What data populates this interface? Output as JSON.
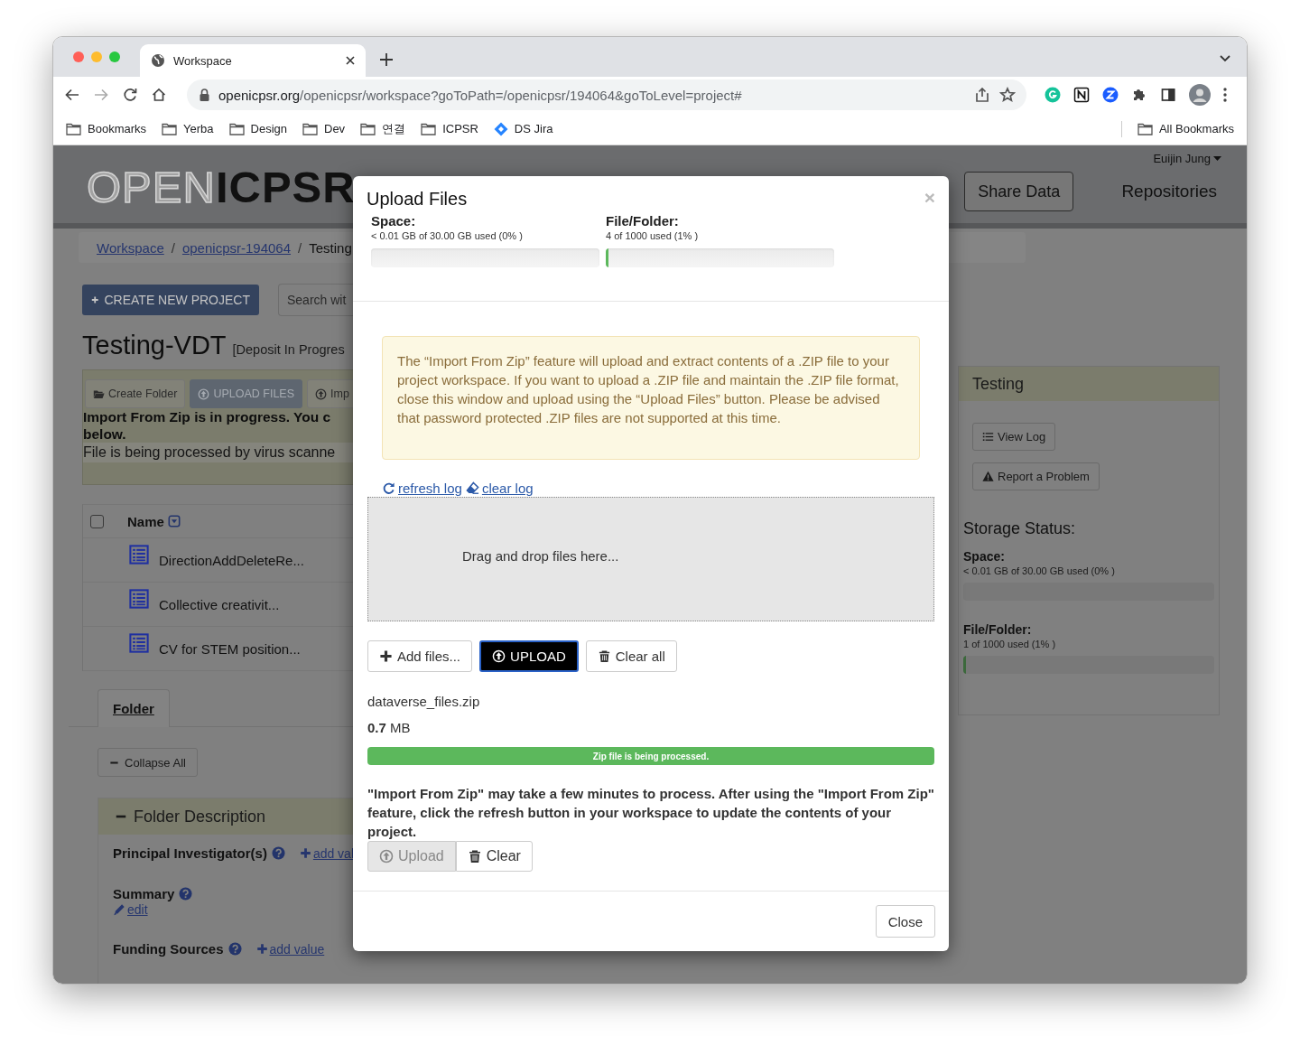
{
  "browser": {
    "tab": {
      "title": "Workspace",
      "selected": true
    },
    "url": {
      "host": "openicpsr.org",
      "path": "/openicpsr/workspace?goToPath=/openicpsr/194064&goToLevel=project#"
    },
    "bookmarks": [
      {
        "label": "Bookmarks",
        "kind": "folder"
      },
      {
        "label": "Yerba",
        "kind": "folder"
      },
      {
        "label": "Design",
        "kind": "folder"
      },
      {
        "label": "Dev",
        "kind": "folder"
      },
      {
        "label": "연결",
        "kind": "folder"
      },
      {
        "label": "ICPSR",
        "kind": "folder"
      },
      {
        "label": "DS Jira",
        "kind": "jira"
      }
    ],
    "all_bookmarks": "All Bookmarks"
  },
  "header": {
    "logo": {
      "light": "OPEN",
      "bold": "ICPSR"
    },
    "user": "Euijin Jung",
    "share_button": "Share Data",
    "nav_link": "Repositories"
  },
  "breadcrumb": [
    {
      "label": "Workspace",
      "kind": "link"
    },
    {
      "label": "/",
      "kind": "separator"
    },
    {
      "label": "openicpsr-194064",
      "kind": "link"
    },
    {
      "label": "/",
      "kind": "separator"
    },
    {
      "label": "Testing",
      "kind": "current"
    }
  ],
  "create_button": "CREATE NEW PROJECT",
  "search": {
    "placeholder": "Search wit"
  },
  "project": {
    "title": "Testing-VDT",
    "status": "[Deposit In Progres"
  },
  "toolbar": [
    {
      "label": "Create Folder",
      "kind": "default"
    },
    {
      "label": "UPLOAD FILES",
      "kind": "primary"
    },
    {
      "label": "Imp",
      "kind": "default"
    }
  ],
  "notice": {
    "lines": [
      "Import From Zip is in progress. You c",
      "below."
    ],
    "status": "File is being processed by virus scanne"
  },
  "table": {
    "select_all": {
      "checked": false
    },
    "columns": [
      "Name"
    ],
    "rows": [
      {
        "name": "DirectionAddDeleteRe..."
      },
      {
        "name": "Collective creativit..."
      },
      {
        "name": "CV for STEM position..."
      }
    ]
  },
  "folder_tabs": [
    {
      "label": "Folder",
      "selected": true
    }
  ],
  "collapse_button": "Collapse All",
  "folder_description": {
    "title": "Folder Description",
    "fields": [
      {
        "label": "Principal Investigator(s)",
        "action": "add val",
        "kind": "add"
      },
      {
        "label": "Summary",
        "action": "edit",
        "kind": "edit"
      },
      {
        "label": "Funding Sources",
        "action": "add value",
        "kind": "add"
      }
    ]
  },
  "side_panel": {
    "title": "Testing",
    "buttons": [
      {
        "label": "View Log",
        "kind": "log"
      },
      {
        "label": "Report a Problem",
        "kind": "report"
      }
    ],
    "storage_title": "Storage Status:",
    "stats": [
      {
        "label": "Space:",
        "usage": "< 0.01 GB of 30.00 GB used (0% )",
        "level": 0
      },
      {
        "label": "File/Folder:",
        "usage": "1 of 1000 used (1% )",
        "level": 0.01
      }
    ]
  },
  "modal": {
    "title": "Upload Files",
    "close": "×",
    "stats": [
      {
        "label": "Space:",
        "usage": "< 0.01 GB of 30.00 GB used (0% )",
        "level": 0
      },
      {
        "label": "File/Folder:",
        "usage": "4 of 1000 used (1% )",
        "level": 0.01
      }
    ],
    "warning": "The “Import From Zip” feature will upload and extract contents of a .ZIP file to your project workspace. If you want to upload a .ZIP file and maintain the .ZIP file format, close this window and upload using the “Upload Files” button. Please be advised that password protected .ZIP files are not supported at this time.",
    "log_links": [
      {
        "label": "refresh log",
        "kind": "refresh"
      },
      {
        "label": "clear log",
        "kind": "clear"
      }
    ],
    "dropzone": "Drag and drop files here...",
    "actions": [
      {
        "label": "Add files...",
        "kind": "add"
      },
      {
        "label": "UPLOAD",
        "kind": "upload"
      },
      {
        "label": "Clear all",
        "kind": "clear"
      }
    ],
    "file": {
      "name": "dataverse_files.zip",
      "size": "**0.7** MB",
      "progress": {
        "level": 1,
        "label": "Zip file is being processed."
      }
    },
    "note": "\"Import From Zip\" may take a few minutes to process. After using the \"Import From Zip\" feature, click the refresh button in your workspace to update the contents of your project.",
    "file_buttons": [
      {
        "label": "Upload",
        "kind": "upload",
        "disabled": true
      },
      {
        "label": "Clear",
        "kind": "clear",
        "disabled": false
      }
    ],
    "footer_button": "Close"
  }
}
